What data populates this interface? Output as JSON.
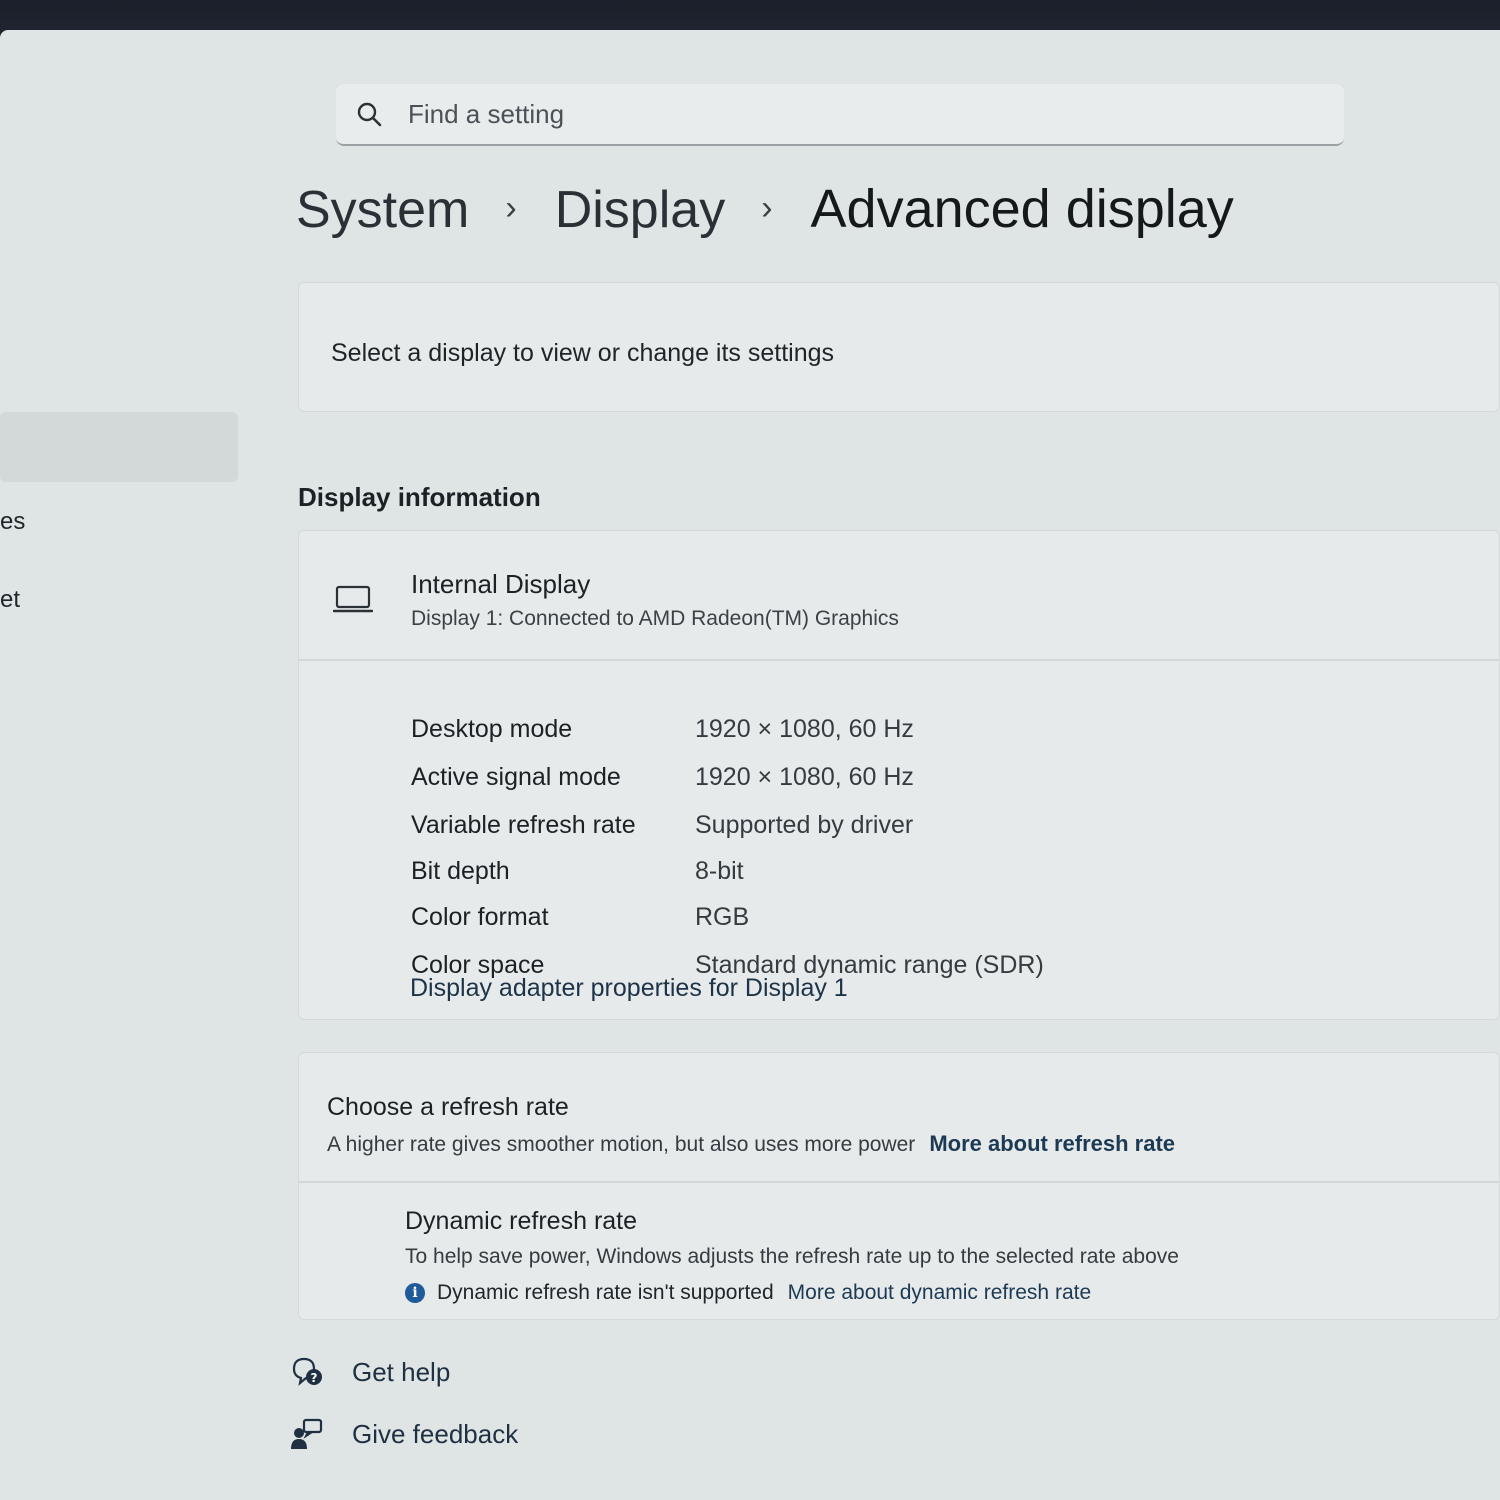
{
  "search": {
    "placeholder": "Find a setting"
  },
  "sidebar": {
    "items": [
      {
        "label": "es"
      },
      {
        "label": "et"
      }
    ]
  },
  "breadcrumb": {
    "items": [
      "System",
      "Display",
      "Advanced display"
    ],
    "separator": "›"
  },
  "select_display": {
    "label": "Select a display to view or change its settings"
  },
  "display_info": {
    "section_title": "Display information",
    "title": "Internal Display",
    "subtitle": "Display 1: Connected to AMD Radeon(TM) Graphics",
    "rows": [
      {
        "label": "Desktop mode",
        "value": "1920 × 1080, 60 Hz"
      },
      {
        "label": "Active signal mode",
        "value": "1920 × 1080, 60 Hz"
      },
      {
        "label": "Variable refresh rate",
        "value": "Supported by driver"
      },
      {
        "label": "Bit depth",
        "value": "8-bit"
      },
      {
        "label": "Color format",
        "value": "RGB"
      },
      {
        "label": "Color space",
        "value": "Standard dynamic range (SDR)"
      }
    ],
    "adapter_link": "Display adapter properties for Display 1"
  },
  "refresh_rate": {
    "title": "Choose a refresh rate",
    "description": "A higher rate gives smoother motion, but also uses more power",
    "link": "More about refresh rate"
  },
  "dynamic_refresh": {
    "title": "Dynamic refresh rate",
    "description": "To help save power, Windows adjusts the refresh rate up to the selected rate above",
    "note": "Dynamic refresh rate isn't supported",
    "link": "More about dynamic refresh rate"
  },
  "footer": {
    "get_help": "Get help",
    "give_feedback": "Give feedback"
  },
  "icons": {
    "search": "search-icon",
    "monitor": "laptop-monitor-icon",
    "info": "info-icon",
    "help": "help-icon",
    "feedback": "feedback-icon"
  },
  "colors": {
    "title_bar": "#1b1f2a",
    "link": "#1d3a55",
    "info_icon": "#1f5a9a"
  }
}
